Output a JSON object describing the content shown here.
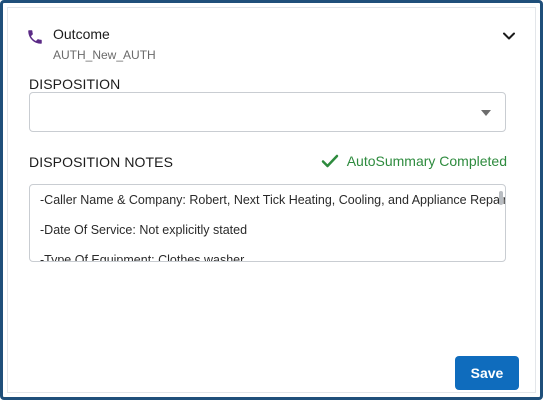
{
  "header": {
    "title": "Outcome",
    "subtitle": "AUTH_New_AUTH"
  },
  "disposition": {
    "label": "DISPOSITION",
    "selected_value": ""
  },
  "notes": {
    "label": "DISPOSITION NOTES",
    "status": "AutoSummary Completed",
    "lines": [
      "-Caller Name & Company: Robert, Next Tick Heating, Cooling, and Appliance Repair",
      "-Date Of Service: Not explicitly stated",
      "-Type Of Equipment: Clothes washer"
    ]
  },
  "actions": {
    "save_label": "Save"
  },
  "colors": {
    "frame": "#1f4f7a",
    "accent_phone": "#5b2a86",
    "success": "#2e8b3e",
    "primary_button": "#0f6cbd"
  },
  "icons": {
    "phone": "phone-icon",
    "chevron": "chevron-down-icon",
    "check": "check-icon",
    "caret": "caret-down-icon"
  }
}
